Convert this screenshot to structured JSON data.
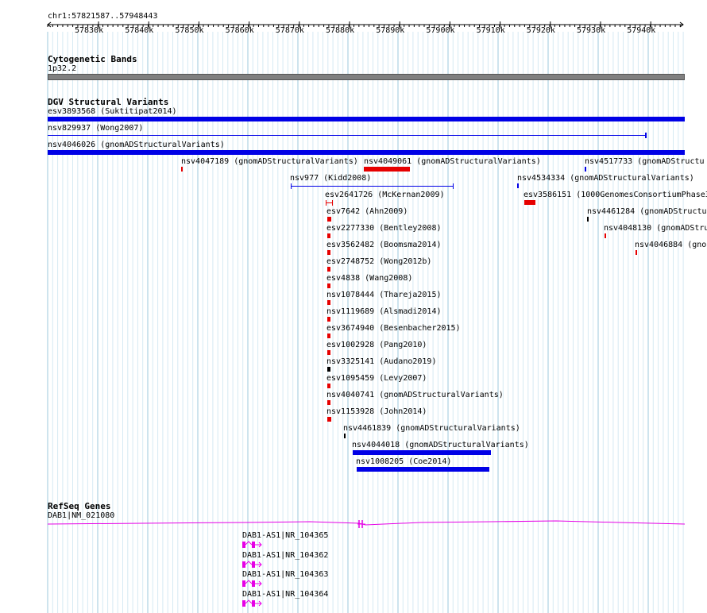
{
  "ruler": {
    "coords": "chr1:57821587..57948443",
    "ticks": [
      "57830k",
      "57840k",
      "57850k",
      "57860k",
      "57870k",
      "57880k",
      "57890k",
      "57900k",
      "57910k",
      "57920k",
      "57930k",
      "57940k"
    ]
  },
  "cyto": {
    "title": "Cytogenetic Bands",
    "band": "1p32.2"
  },
  "dgv": {
    "title": "DGV Structural Variants",
    "items": [
      "esv3893568 (Suktitipat2014)",
      "nsv829937 (Wong2007)",
      "nsv4046026 (gnomADStructuralVariants)",
      "nsv4047189 (gnomADStructuralVariants)",
      "nsv4049061 (gnomADStructuralVariants)",
      "nsv4517733 (gnomADStructu",
      "nsv977 (Kidd2008)",
      "nsv4534334 (gnomADStructuralVariants)",
      "esv2641726 (McKernan2009)",
      "esv3586151 (1000GenomesConsortiumPhase3",
      "esv7642 (Ahn2009)",
      "nsv4461284 (gnomADStructur",
      "esv2277330 (Bentley2008)",
      "nsv4048130 (gnomADStru",
      "esv3562482 (Boomsma2014)",
      "nsv4046884 (gno",
      "esv2748752 (Wong2012b)",
      "esv4838 (Wang2008)",
      "nsv1078444 (Thareja2015)",
      "nsv1119689 (Alsmadi2014)",
      "esv3674940 (Besenbacher2015)",
      "esv1002928 (Pang2010)",
      "nsv3325141 (Audano2019)",
      "esv1095459 (Levy2007)",
      "nsv4040741 (gnomADStructuralVariants)",
      "nsv1153928 (John2014)",
      "nsv4461839 (gnomADStructuralVariants)",
      "nsv4044018 (gnomADStructuralVariants)",
      "nsv1008205 (Coe2014)"
    ]
  },
  "refseq": {
    "title": "RefSeq Genes",
    "main_gene": "DAB1|NM_021080",
    "as_genes": [
      "DAB1-AS1|NR_104365",
      "DAB1-AS1|NR_104362",
      "DAB1-AS1|NR_104363",
      "DAB1-AS1|NR_104364"
    ]
  },
  "colors": {
    "blue": "#0000e6",
    "red": "#e60000",
    "magenta": "#e600e6",
    "gridline": "#aad4e6",
    "band_gray": "#808080"
  }
}
